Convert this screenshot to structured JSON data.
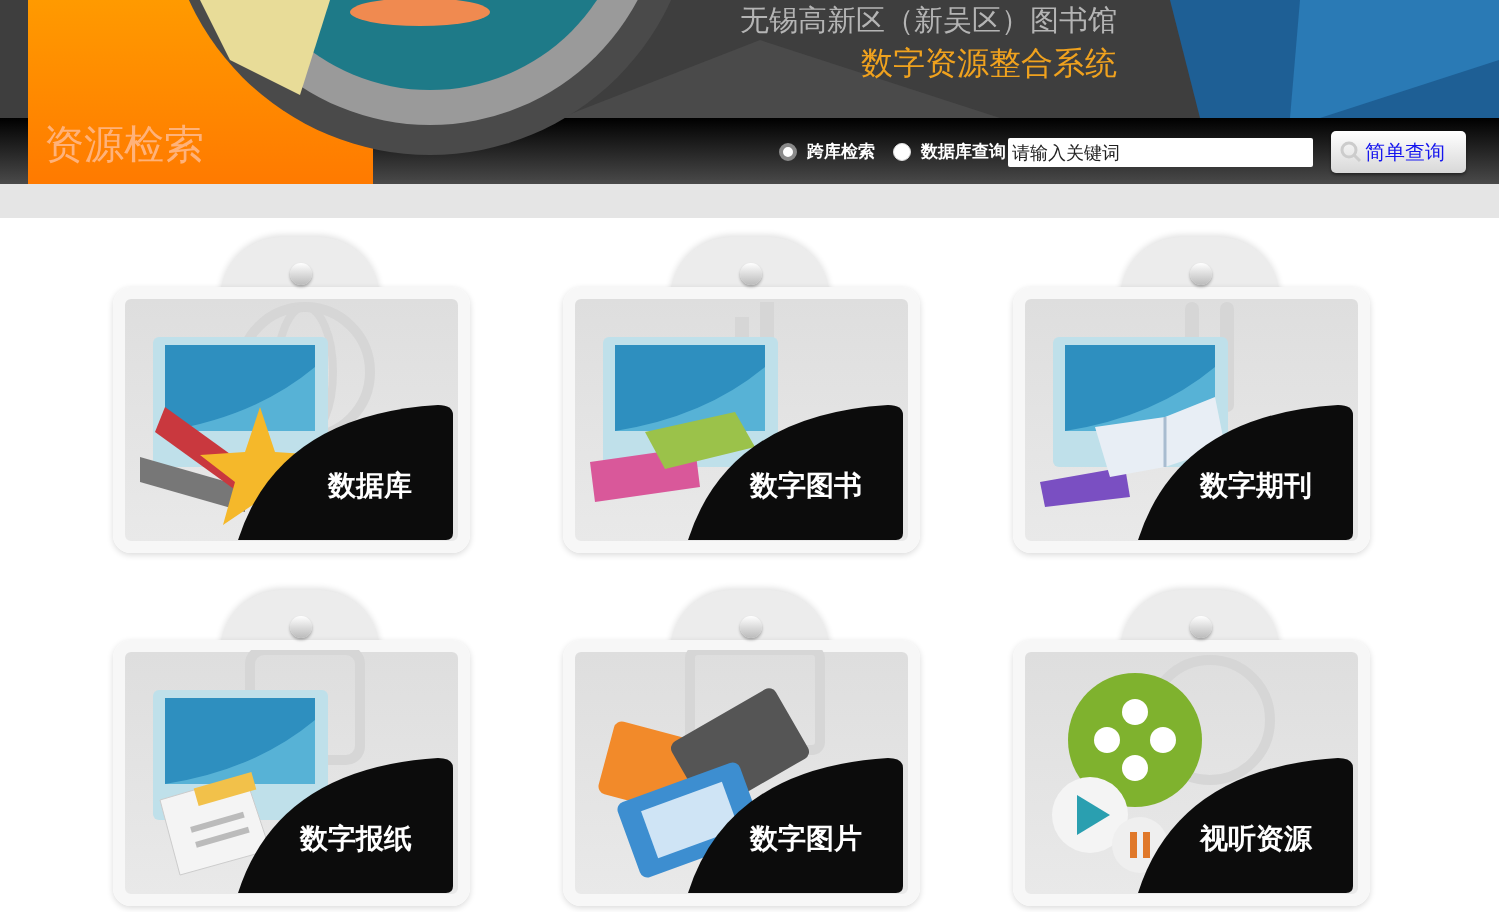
{
  "header": {
    "library_name": "无锡高新区（新吴区）图书馆",
    "system_name": "数字资源整合系统",
    "section_title": "资源检索"
  },
  "search": {
    "modes": [
      {
        "label": "跨库检索",
        "selected": true
      },
      {
        "label": "数据库查询",
        "selected": false
      }
    ],
    "placeholder": "请输入关键词",
    "button": "简单查询"
  },
  "categories": [
    {
      "label": "数据库",
      "kind": "database"
    },
    {
      "label": "数字图书",
      "kind": "ebook"
    },
    {
      "label": "数字期刊",
      "kind": "journal"
    },
    {
      "label": "数字报纸",
      "kind": "newspaper"
    },
    {
      "label": "数字图片",
      "kind": "images"
    },
    {
      "label": "视听资源",
      "kind": "av"
    }
  ]
}
